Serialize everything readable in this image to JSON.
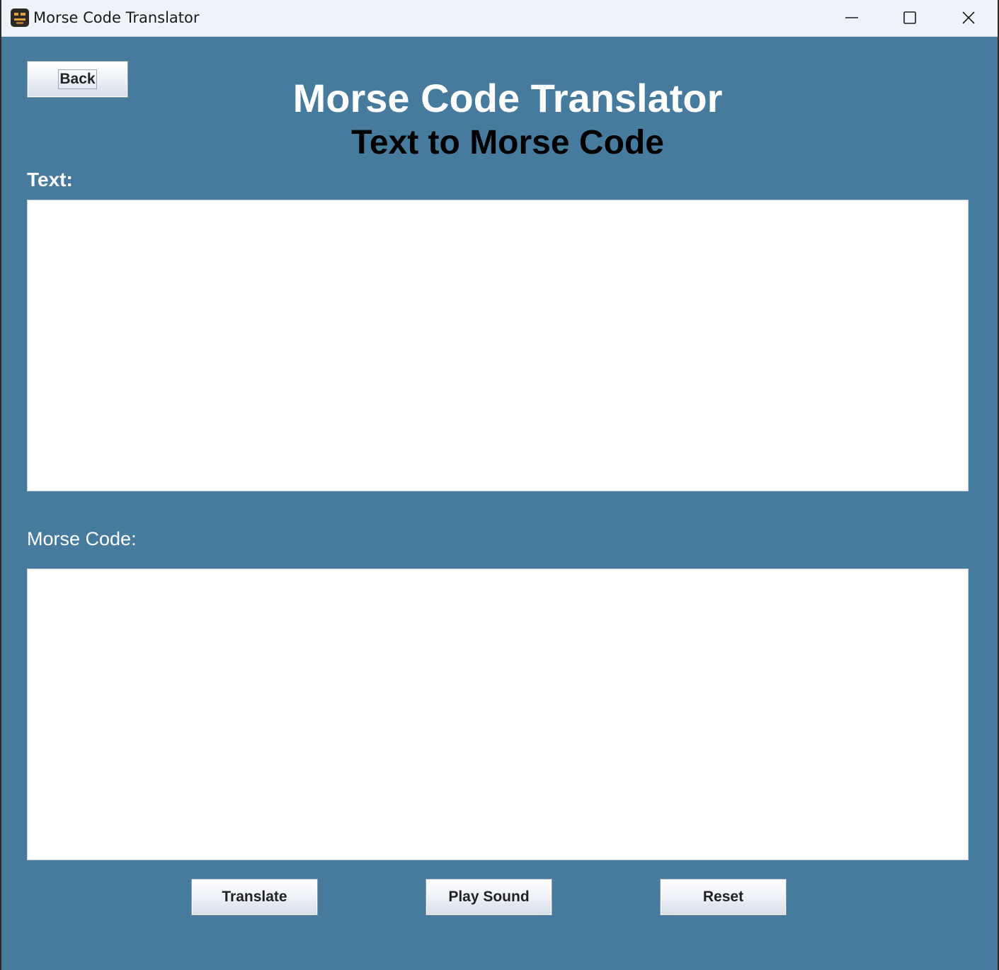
{
  "window": {
    "title": "Morse Code Translator",
    "controls": {
      "minimize": "minimize-icon",
      "maximize": "maximize-icon",
      "close": "close-icon"
    }
  },
  "header": {
    "back_label": "Back",
    "title": "Morse Code Translator",
    "subtitle": "Text to Morse Code"
  },
  "input": {
    "label": "Text:",
    "value": ""
  },
  "output": {
    "label": "Morse Code:",
    "value": ""
  },
  "actions": {
    "translate_label": "Translate",
    "play_sound_label": "Play Sound",
    "reset_label": "Reset"
  },
  "colors": {
    "background": "#467b9e",
    "titlebar": "#eef2f9",
    "title_text": "#ffffff",
    "subtitle_text": "#000000"
  }
}
